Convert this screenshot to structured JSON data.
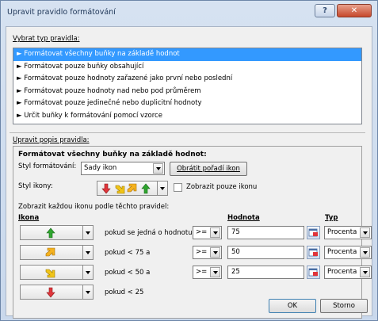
{
  "window": {
    "title": "Upravit pravidlo formátování",
    "help_label": "?",
    "close_label": "✕"
  },
  "rule_type": {
    "label": "Vybrat typ pravidla:",
    "items": [
      "► Formátovat všechny buňky na základě hodnot",
      "► Formátovat pouze buňky obsahující",
      "► Formátovat pouze hodnoty zařazené jako první nebo poslední",
      "► Formátovat pouze hodnoty nad nebo pod průměrem",
      "► Formátovat pouze jedinečné nebo duplicitní hodnoty",
      "► Určit buňky k formátování pomocí vzorce"
    ],
    "selected_index": 0
  },
  "description": {
    "label": "Upravit popis pravidla:",
    "heading": "Formátovat všechny buňky na základě hodnot:",
    "format_style_label": "Styl formátování:",
    "format_style_value": "Sady ikon",
    "reverse_button": "Obrátit pořadí ikon",
    "icon_style_label": "Styl ikony:",
    "show_icon_only_label": "Zobrazit pouze ikonu",
    "show_icon_only_checked": false,
    "rules_caption": "Zobrazit každou ikonu podle těchto pravidel:",
    "col_icon": "Ikona",
    "col_value": "Hodnota",
    "col_type": "Typ",
    "rows": [
      {
        "icon": "green-up-arrow-icon",
        "condition": "pokud se jedná o hodnotu",
        "operator": ">=",
        "value": "75",
        "type": "Procenta"
      },
      {
        "icon": "orange-up-right-arrow-icon",
        "condition": "pokud < 75 a",
        "operator": ">=",
        "value": "50",
        "type": "Procenta"
      },
      {
        "icon": "yellow-down-right-arrow-icon",
        "condition": "pokud < 50 a",
        "operator": ">=",
        "value": "25",
        "type": "Procenta"
      },
      {
        "icon": "red-down-arrow-icon",
        "condition": "pokud < 25"
      }
    ]
  },
  "footer": {
    "ok_label": "OK",
    "cancel_label": "Storno"
  },
  "colors": {
    "selection": "#3399ff",
    "arrow_green": "#2fa52f",
    "arrow_orange": "#f5b21e",
    "arrow_yellow": "#f0c419",
    "arrow_red": "#e0353b"
  }
}
